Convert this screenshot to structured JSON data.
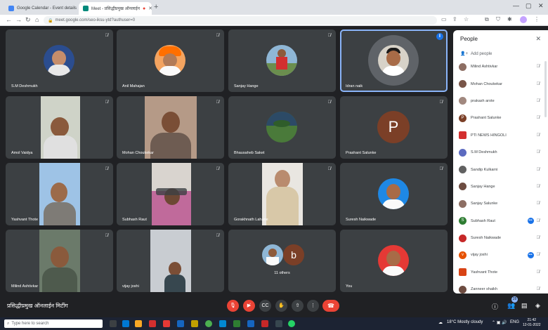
{
  "browser": {
    "tabs": [
      {
        "label": "Google Calendar - Event details",
        "active": false
      },
      {
        "label": "Meet - प्रसिद्धीप्रमुख ऑनलाईन",
        "active": true
      }
    ],
    "url": "meet.google.com/seo-iksu-ytd?authuser=0"
  },
  "tiles": [
    {
      "name": "S.M Deshmukh",
      "kind": "avatar",
      "muted": true
    },
    {
      "name": "Anil Mahajan",
      "kind": "avatar",
      "muted": true
    },
    {
      "name": "Sanjay Hange",
      "kind": "avatar",
      "muted": true
    },
    {
      "name": "Idran naik",
      "kind": "avatar",
      "speaking": true
    },
    {
      "name": "Amol Vaidya",
      "kind": "video",
      "muted": true
    },
    {
      "name": "Mohan Choukekar",
      "kind": "video",
      "muted": true
    },
    {
      "name": "Bhausaheb Saket",
      "kind": "avatar",
      "muted": true
    },
    {
      "name": "Prashant Salunke",
      "kind": "letter",
      "letter": "P",
      "muted": true
    },
    {
      "name": "Yashvant Thote",
      "kind": "video",
      "muted": true
    },
    {
      "name": "Subhash Raut",
      "kind": "video",
      "muted": true
    },
    {
      "name": "Gorakhnath Lahane",
      "kind": "video",
      "muted": true
    },
    {
      "name": "Suresh Naikwade",
      "kind": "avatar",
      "muted": true
    },
    {
      "name": "Milind Ashtivkar",
      "kind": "video",
      "muted": true
    },
    {
      "name": "vijay joshi",
      "kind": "video",
      "muted": true
    },
    {
      "name": "11 others",
      "kind": "others",
      "letter": "b"
    },
    {
      "name": "You",
      "kind": "avatar",
      "muted": true
    }
  ],
  "people_panel": {
    "title": "People",
    "add_label": "Add people",
    "people": [
      {
        "name": "Milind Ashtivkar",
        "color": "#8d6e63"
      },
      {
        "name": "Mohan Choukekar",
        "color": "#795548"
      },
      {
        "name": "prakash arote",
        "color": "#a1887f"
      },
      {
        "name": "Prashant Salunke",
        "color": "#7b3f27",
        "letter": "P"
      },
      {
        "name": "PTI NEWS HINGOLI",
        "color": "#d32f2f"
      },
      {
        "name": "S.M Deshmukh",
        "color": "#5c6bc0"
      },
      {
        "name": "Sandip Kulkarni",
        "color": "#616161"
      },
      {
        "name": "Sanjay Hange",
        "color": "#6d4c41"
      },
      {
        "name": "Sanjay Salunke",
        "color": "#8d6e63"
      },
      {
        "name": "Subhash Raut",
        "color": "#2e7d32",
        "letter": "S",
        "more": true
      },
      {
        "name": "Suresh Naikwade",
        "color": "#c62828"
      },
      {
        "name": "vijay joshi",
        "color": "#e65100",
        "letter": "v",
        "more": true
      },
      {
        "name": "Yashvant Thote",
        "color": "#d84315"
      },
      {
        "name": "Zanneer shaikh",
        "color": "#6d4c41"
      }
    ]
  },
  "meeting": {
    "title": "प्रसिद्धीप्रमुख ऑनलाईन मिटींग",
    "participants_count": "28"
  },
  "taskbar": {
    "search_placeholder": "Type here to search",
    "weather": "18°C  Mostly cloudy",
    "lang": "ENG",
    "time": "21:42",
    "date": "12-01-2022"
  }
}
